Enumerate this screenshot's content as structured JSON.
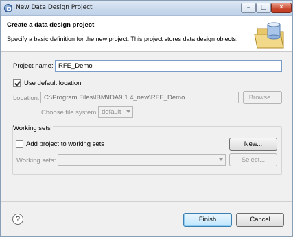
{
  "window": {
    "title": "New Data Design Project",
    "minimize_glyph": "–",
    "maximize_glyph": "□",
    "close_glyph": "✕"
  },
  "banner": {
    "title": "Create a data design project",
    "description": "Specify a basic definition for the new project. This project stores data design objects."
  },
  "project": {
    "name_label": "Project name:",
    "name_value": "RFE_Demo"
  },
  "location": {
    "use_default_label": "Use default location",
    "use_default_checked": true,
    "location_label": "Location:",
    "location_value": "C:\\Program Files\\IBM\\IDA9.1.4_new\\RFE_Demo",
    "browse_label": "Browse...",
    "file_system_label": "Choose file system:",
    "file_system_value": "default"
  },
  "working_sets": {
    "group_title": "Working sets",
    "add_label": "Add project to working sets",
    "add_checked": false,
    "new_label": "New...",
    "sets_label": "Working sets:",
    "sets_value": "",
    "select_label": "Select..."
  },
  "footer": {
    "help_glyph": "?",
    "finish_label": "Finish",
    "cancel_label": "Cancel"
  }
}
